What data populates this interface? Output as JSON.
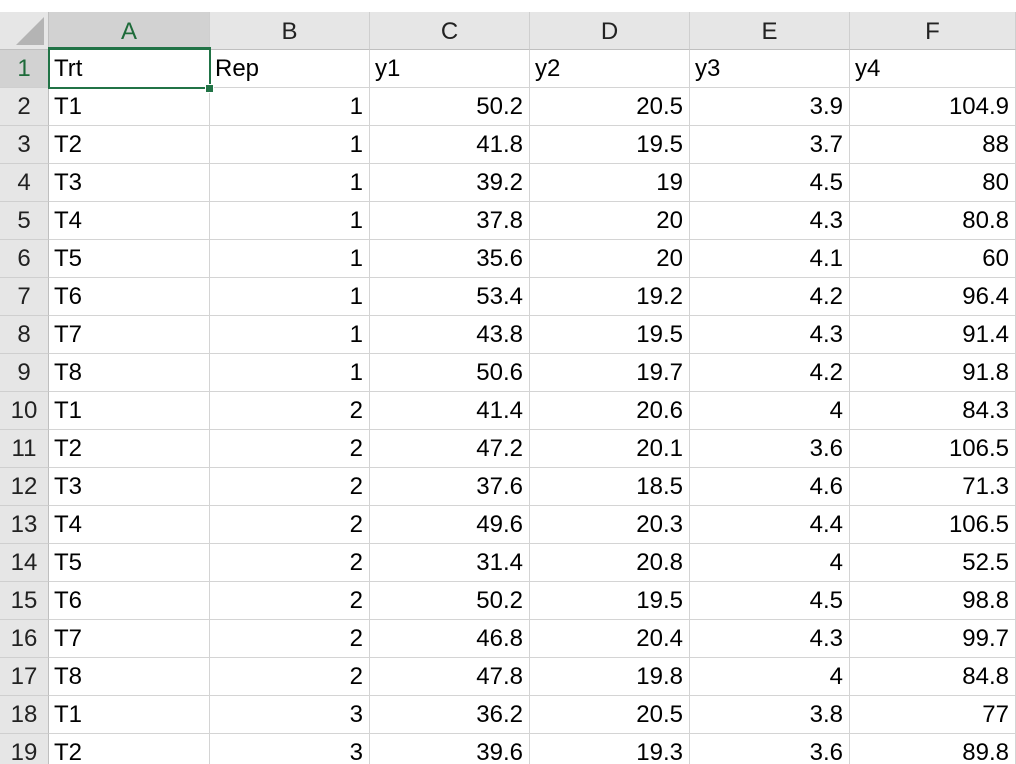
{
  "columns": [
    "A",
    "B",
    "C",
    "D",
    "E",
    "F"
  ],
  "selected_cell": "A1",
  "rows": [
    {
      "n": "1",
      "cells": [
        "Trt",
        "Rep",
        "y1",
        "y2",
        "y3",
        "y4"
      ]
    },
    {
      "n": "2",
      "cells": [
        "T1",
        "1",
        "50.2",
        "20.5",
        "3.9",
        "104.9"
      ]
    },
    {
      "n": "3",
      "cells": [
        "T2",
        "1",
        "41.8",
        "19.5",
        "3.7",
        "88"
      ]
    },
    {
      "n": "4",
      "cells": [
        "T3",
        "1",
        "39.2",
        "19",
        "4.5",
        "80"
      ]
    },
    {
      "n": "5",
      "cells": [
        "T4",
        "1",
        "37.8",
        "20",
        "4.3",
        "80.8"
      ]
    },
    {
      "n": "6",
      "cells": [
        "T5",
        "1",
        "35.6",
        "20",
        "4.1",
        "60"
      ]
    },
    {
      "n": "7",
      "cells": [
        "T6",
        "1",
        "53.4",
        "19.2",
        "4.2",
        "96.4"
      ]
    },
    {
      "n": "8",
      "cells": [
        "T7",
        "1",
        "43.8",
        "19.5",
        "4.3",
        "91.4"
      ]
    },
    {
      "n": "9",
      "cells": [
        "T8",
        "1",
        "50.6",
        "19.7",
        "4.2",
        "91.8"
      ]
    },
    {
      "n": "10",
      "cells": [
        "T1",
        "2",
        "41.4",
        "20.6",
        "4",
        "84.3"
      ]
    },
    {
      "n": "11",
      "cells": [
        "T2",
        "2",
        "47.2",
        "20.1",
        "3.6",
        "106.5"
      ]
    },
    {
      "n": "12",
      "cells": [
        "T3",
        "2",
        "37.6",
        "18.5",
        "4.6",
        "71.3"
      ]
    },
    {
      "n": "13",
      "cells": [
        "T4",
        "2",
        "49.6",
        "20.3",
        "4.4",
        "106.5"
      ]
    },
    {
      "n": "14",
      "cells": [
        "T5",
        "2",
        "31.4",
        "20.8",
        "4",
        "52.5"
      ]
    },
    {
      "n": "15",
      "cells": [
        "T6",
        "2",
        "50.2",
        "19.5",
        "4.5",
        "98.8"
      ]
    },
    {
      "n": "16",
      "cells": [
        "T7",
        "2",
        "46.8",
        "20.4",
        "4.3",
        "99.7"
      ]
    },
    {
      "n": "17",
      "cells": [
        "T8",
        "2",
        "47.8",
        "19.8",
        "4",
        "84.8"
      ]
    },
    {
      "n": "18",
      "cells": [
        "T1",
        "3",
        "36.2",
        "20.5",
        "3.8",
        "77"
      ]
    },
    {
      "n": "19",
      "cells": [
        "T2",
        "3",
        "39.6",
        "19.3",
        "3.6",
        "89.8"
      ]
    }
  ],
  "colors": {
    "accent": "#217346",
    "header_bg": "#e6e6e6",
    "gridline": "#d4d4d4"
  }
}
